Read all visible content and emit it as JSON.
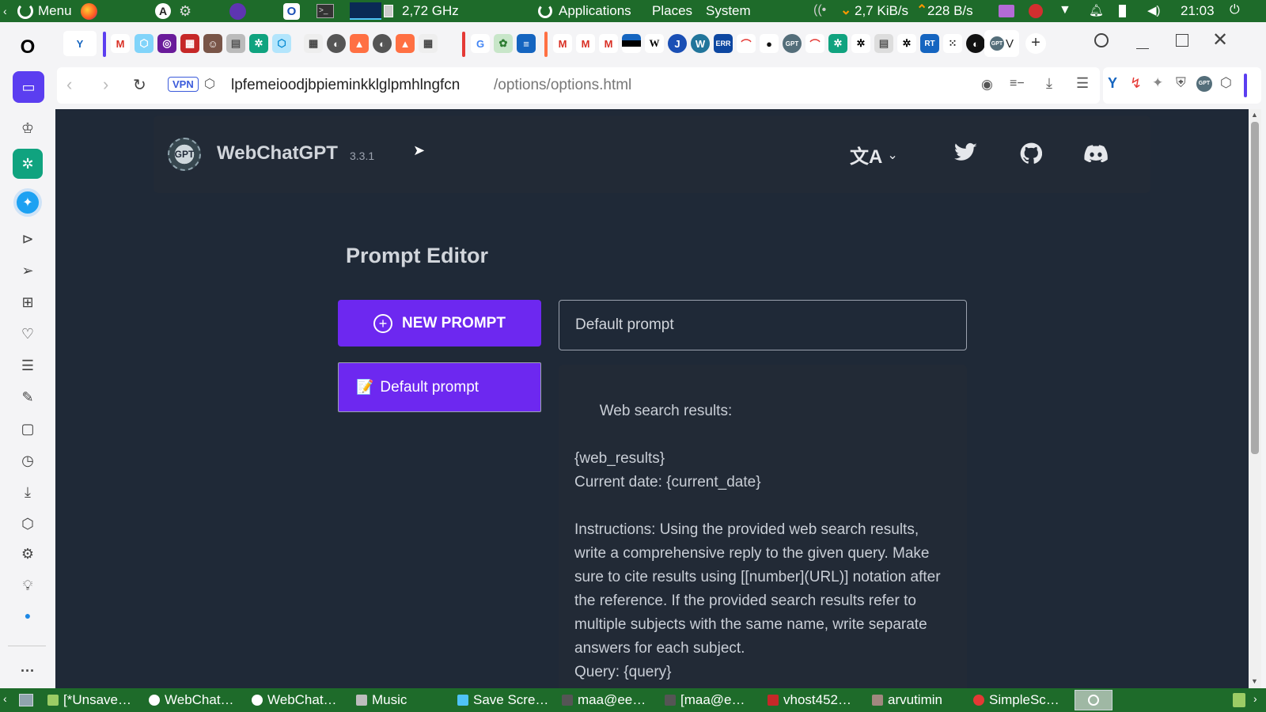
{
  "system_bar": {
    "menu_label": "Menu",
    "cpu_freq": "2,72 GHz",
    "applications": "Applications",
    "places": "Places",
    "system": "System",
    "net_down": "2,7 KiB/s",
    "net_up": "228 B/s",
    "clock": "21:03"
  },
  "browser": {
    "vpn_badge": "VPN",
    "url_host": "lpfemeioodjbpieminkklglpmhlngfcn",
    "url_path": "/options/options.html",
    "active_tab_label": "V"
  },
  "app": {
    "name": "WebChatGPT",
    "version": "3.3.1",
    "logo_text": "GPT",
    "section_title": "Prompt Editor",
    "new_prompt_label": "NEW PROMPT",
    "prompts": [
      {
        "emoji": "📝",
        "label": "Default prompt"
      }
    ],
    "prompt_name_value": "Default prompt",
    "prompt_body": "Web search results:\n\n{web_results}\nCurrent date: {current_date}\n\nInstructions: Using the provided web search results, write a comprehensive reply to the given query. Make sure to cite results using [[number](URL)] notation after the reference. If the provided search results refer to multiple subjects with the same name, write separate answers for each subject.\nQuery: {query}"
  },
  "taskbar": {
    "items": [
      "[*Unsave…",
      "WebChat…",
      "WebChat…",
      "Music",
      "Save Scre…",
      "maa@ee…",
      "[maa@e…",
      "vhost452…",
      "arvutimin",
      "SimpleSc…"
    ]
  },
  "colors": {
    "accent": "#6d28f0",
    "page_bg": "#1f2937",
    "card_bg": "#222a36",
    "system_bar": "#1e6b2a"
  }
}
